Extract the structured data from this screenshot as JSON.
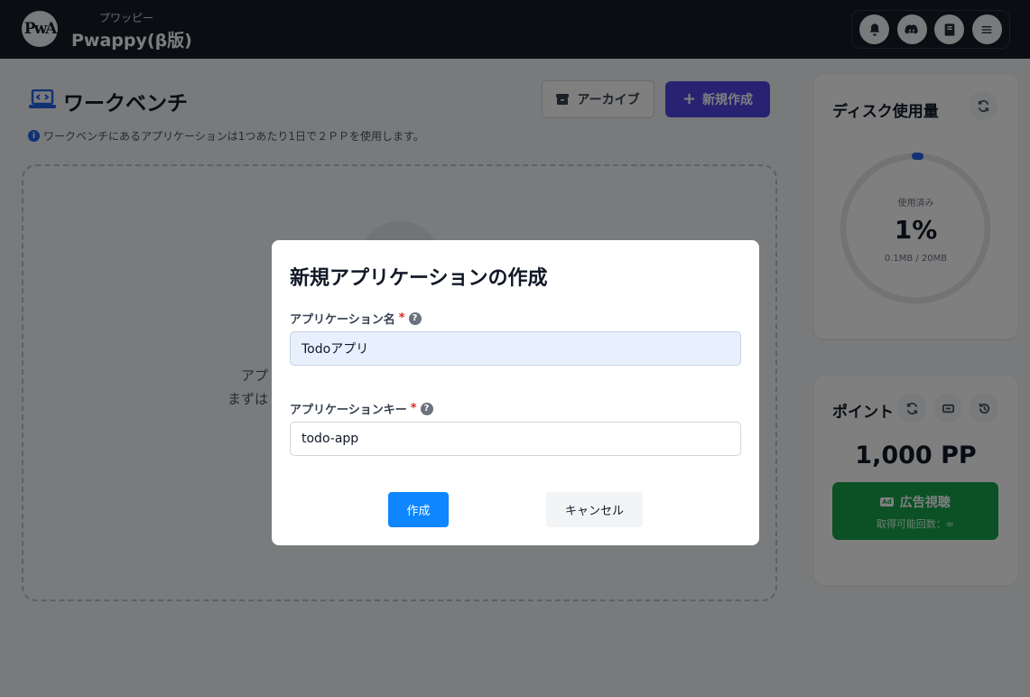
{
  "header": {
    "logo_text": "PwA",
    "brand_kana": "プワッピー",
    "brand_name": "Pwappy(β版)",
    "icons": [
      "bell-icon",
      "discord-icon",
      "book-icon",
      "menu-icon"
    ]
  },
  "workbench": {
    "title": "ワークベンチ",
    "info": "ワークベンチにあるアプリケーションは1つあたり1日で２ＰＰを使用します。",
    "archive_label": "アーカイブ",
    "new_label": "新規作成",
    "empty_line1": "アプ",
    "empty_line2": "まずは"
  },
  "disk": {
    "title": "ディスク使用量",
    "used_label": "使用済み",
    "percent": "1%",
    "usage_fraction": 0.01,
    "detail": "0.1MB / 20MB"
  },
  "points": {
    "title": "ポイント",
    "value": "1,000 PP",
    "ad_label": "広告視聴",
    "ad_badge": "Ad",
    "ad_sub": "取得可能回数：∞"
  },
  "modal": {
    "title": "新規アプリケーションの作成",
    "name_label": "アプリケーション名",
    "name_value": "Todoアプリ",
    "key_label": "アプリケーションキー",
    "key_value": "todo-app",
    "required_mark": "*",
    "help_mark": "?",
    "create_label": "作成",
    "cancel_label": "キャンセル"
  },
  "colors": {
    "header_bg": "#141a25",
    "primary": "#4f46e5",
    "create_button": "#0d86ff",
    "ad_button": "#16a34a"
  }
}
